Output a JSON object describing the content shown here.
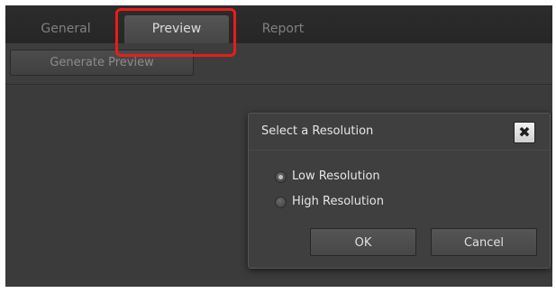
{
  "tabs": {
    "general": "General",
    "preview": "Preview",
    "report": "Report",
    "active": "Preview"
  },
  "toolbar": {
    "generate_preview_label": "Generate Preview"
  },
  "dialog": {
    "title": "Select a Resolution",
    "close_icon": "close-x",
    "options": [
      {
        "label": "Low Resolution",
        "selected": true
      },
      {
        "label": "High Resolution",
        "selected": false
      }
    ],
    "ok_label": "OK",
    "cancel_label": "Cancel"
  },
  "colors": {
    "highlight": "#e81c1c",
    "background": "#3b3b3b"
  }
}
